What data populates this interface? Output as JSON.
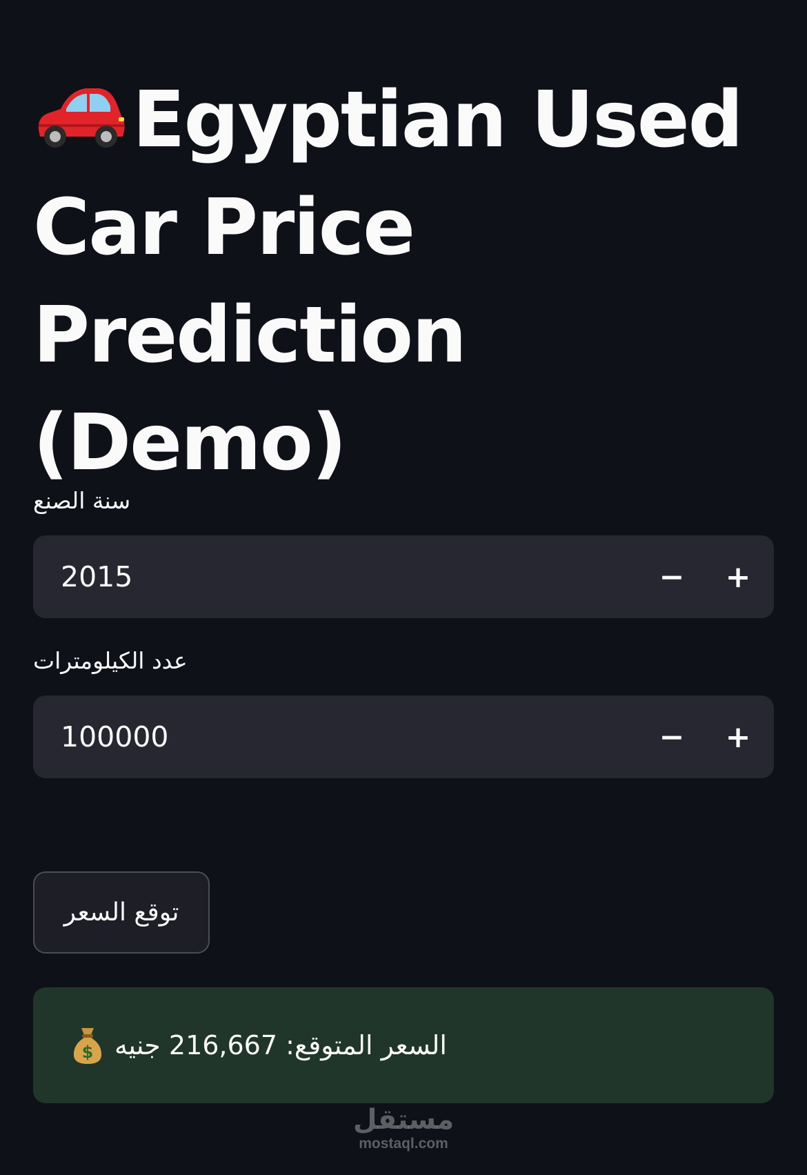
{
  "page": {
    "title": "Egyptian Used Car Price Prediction (Demo)",
    "title_icon": "red-car-icon",
    "background_color": "#0e1117",
    "text_color": "#fafafa"
  },
  "form": {
    "year": {
      "label": "سنة الصنع",
      "value": "2015",
      "decrement_label": "−",
      "increment_label": "+"
    },
    "kilometers": {
      "label": "عدد الكيلومترات",
      "value": "100000",
      "decrement_label": "−",
      "increment_label": "+"
    },
    "predict_button_label": "توقع السعر"
  },
  "result": {
    "icon": "money-bag-icon",
    "text": "السعر المتوقع: 216,667 جنيه",
    "background_color": "#21362a"
  },
  "watermark": {
    "arabic": "مستقل",
    "latin": "mostaql.com"
  }
}
